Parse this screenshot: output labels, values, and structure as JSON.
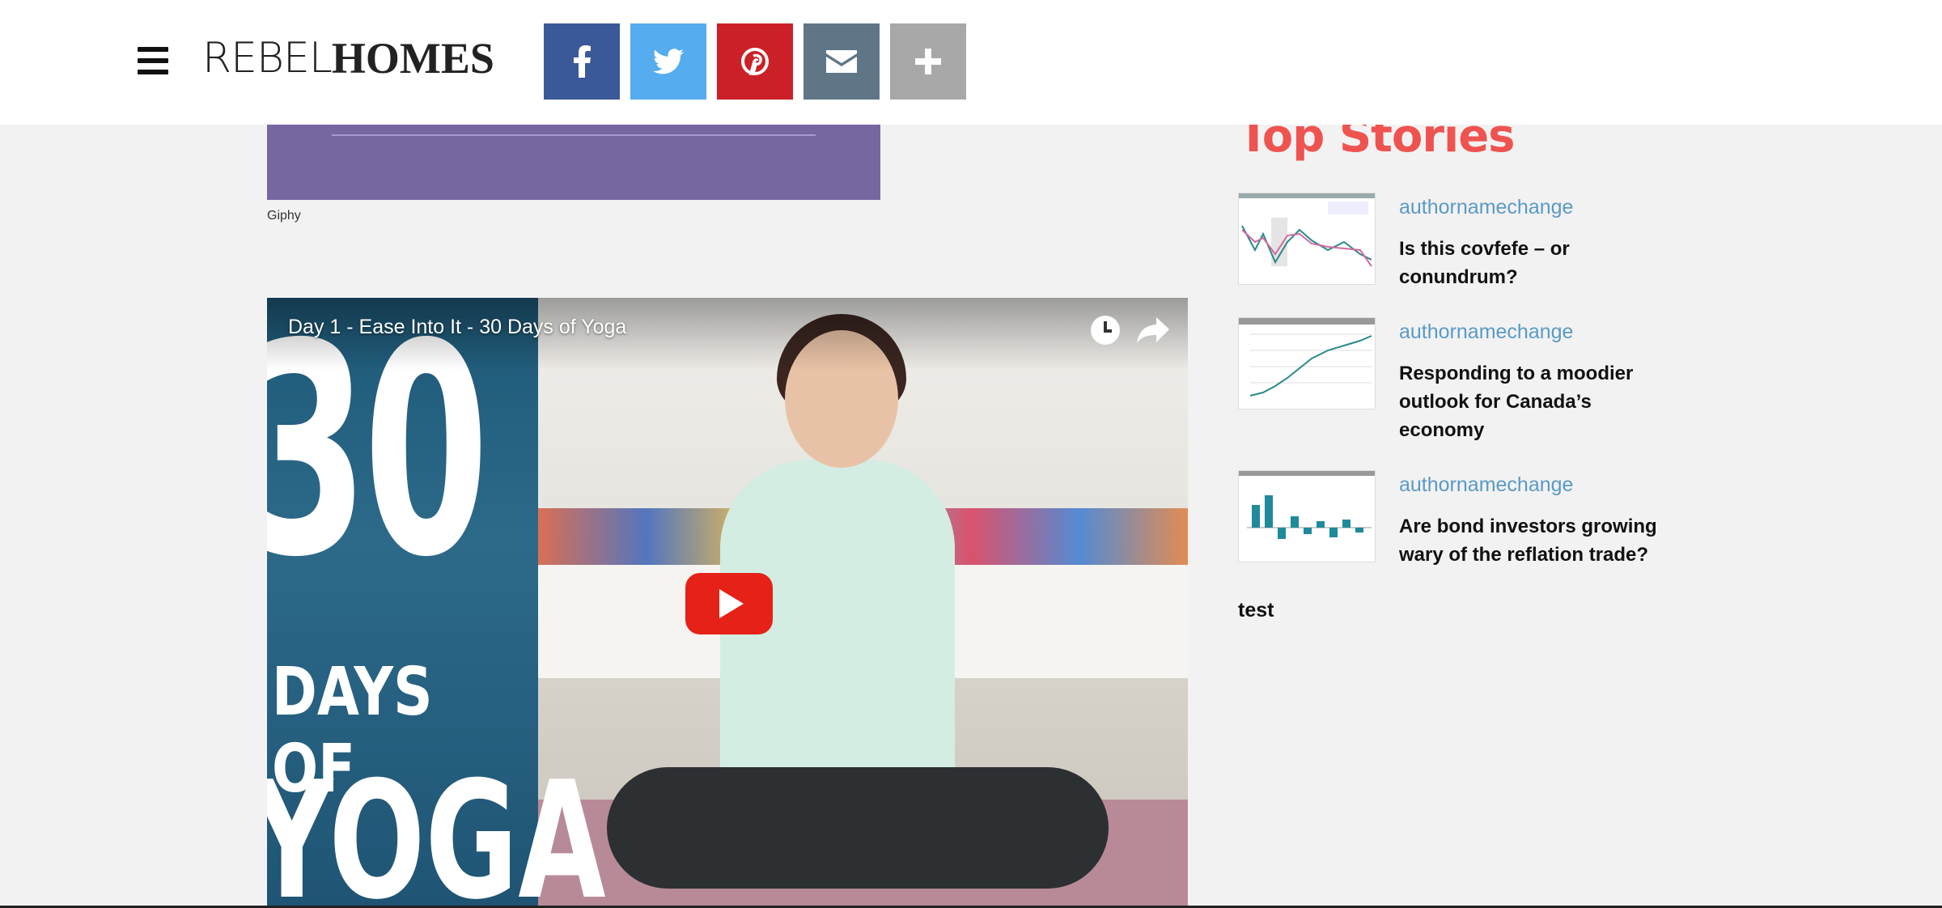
{
  "header": {
    "logo_light": "REBEL",
    "logo_bold": "HOMES",
    "share": [
      {
        "name": "facebook",
        "icon": "facebook-icon",
        "color": "#3b5998"
      },
      {
        "name": "twitter",
        "icon": "twitter-icon",
        "color": "#55acee"
      },
      {
        "name": "pinterest",
        "icon": "pinterest-icon",
        "color": "#cb2027"
      },
      {
        "name": "email",
        "icon": "email-icon",
        "color": "#5f7687"
      },
      {
        "name": "more",
        "icon": "plus-icon",
        "color": "#a8a8a8"
      }
    ]
  },
  "article": {
    "image_caption": "Giphy",
    "video": {
      "title": "Day 1 - Ease Into It - 30 Days of Yoga",
      "thumb_big": "30",
      "thumb_days": "DAYS OF",
      "thumb_yoga": "YOGA"
    }
  },
  "sidebar": {
    "heading": "Top Stories",
    "stories": [
      {
        "author": "authornamechange",
        "title": "Is this covfefe – or conundrum?"
      },
      {
        "author": "authornamechange",
        "title": "Responding to a moodier outlook for Canada’s economy"
      },
      {
        "author": "authornamechange",
        "title": "Are bond investors growing wary of the reflation trade?"
      }
    ],
    "footer_text": "test"
  },
  "colors": {
    "accent_red": "#ef5350",
    "link_blue": "#5a9ac6",
    "youtube_red": "#e62117"
  }
}
